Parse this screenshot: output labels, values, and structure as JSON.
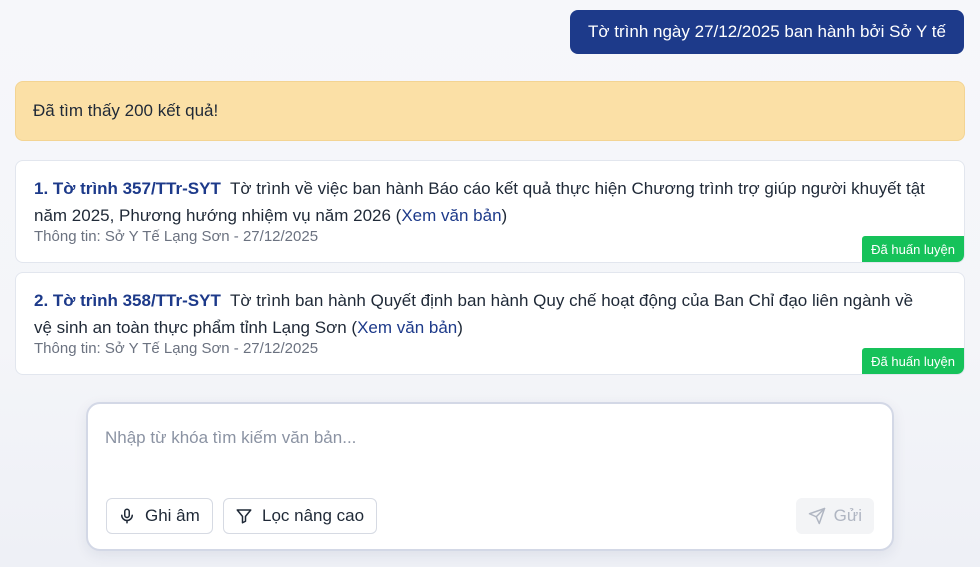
{
  "chat": {
    "user_query": "Tờ trình ngày 27/12/2025 ban hành bởi Sở Y tế"
  },
  "results": {
    "banner_text": "Đã tìm thấy 200 kết quả!",
    "items": [
      {
        "title": "1. Tờ trình 357/TTr-SYT",
        "summary": "Tờ trình về việc ban hành Báo cáo kết quả thực hiện Chương trình trợ giúp người khuyết tật năm 2025, Phương hướng nhiệm vụ năm 2026",
        "link_text": "Xem văn bản",
        "meta": "Thông tin: Sở Y Tế Lạng Sơn - 27/12/2025",
        "badge": "Đã huấn luyện"
      },
      {
        "title": "2. Tờ trình 358/TTr-SYT",
        "summary": "Tờ trình ban hành Quyết định ban hành Quy chế hoạt động của Ban Chỉ đạo liên ngành về vệ sinh an toàn thực phẩm tỉnh Lạng Sơn",
        "link_text": "Xem văn bản",
        "meta": "Thông tin: Sở Y Tế Lạng Sơn - 27/12/2025",
        "badge": "Đã huấn luyện"
      }
    ]
  },
  "composer": {
    "placeholder": "Nhập từ khóa tìm kiếm văn bản...",
    "value": "",
    "record_label": "Ghi âm",
    "filter_label": "Lọc nâng cao",
    "send_label": "Gửi",
    "icons": {
      "record": "microphone-icon",
      "filter": "funnel-icon",
      "send": "paper-plane-icon"
    }
  },
  "colors": {
    "primary": "#1d3a8a",
    "banner_bg": "#fbe0a6",
    "badge_bg": "#16c25a",
    "muted_text": "#6b7280"
  }
}
